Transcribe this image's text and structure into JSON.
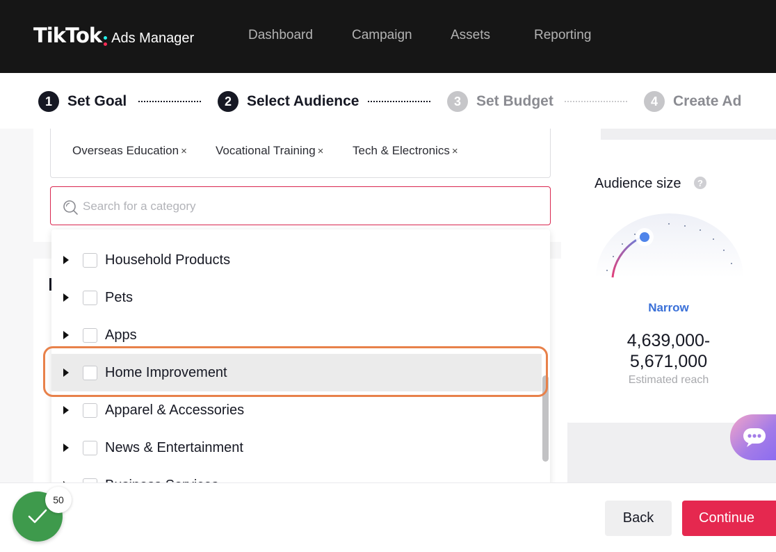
{
  "header": {
    "logo_main": "TikTok",
    "logo_sub": "Ads Manager",
    "nav": [
      "Dashboard",
      "Campaign",
      "Assets",
      "Reporting"
    ]
  },
  "steps": [
    {
      "num": "1",
      "label": "Set Goal",
      "state": "done"
    },
    {
      "num": "2",
      "label": "Select Audience",
      "state": "active"
    },
    {
      "num": "3",
      "label": "Set Budget",
      "state": "inactive"
    },
    {
      "num": "4",
      "label": "Create Ad",
      "state": "inactive"
    }
  ],
  "selected_tags": [
    "Overseas Education",
    "Vocational Training",
    "Tech & Electronics"
  ],
  "tag_remove_symbol": "×",
  "search": {
    "placeholder": "Search for a category",
    "value": ""
  },
  "categories": [
    "Household Products",
    "Pets",
    "Apps",
    "Home Improvement",
    "Apparel & Accessories",
    "News & Entertainment",
    "Business Services"
  ],
  "highlighted_category": "Home Improvement",
  "audience": {
    "title": "Audience size",
    "help_icon": "?",
    "level": "Narrow",
    "range_line1": "4,639,000-",
    "range_line2": "5,671,000",
    "subtitle": "Estimated reach"
  },
  "footer": {
    "back_label": "Back",
    "continue_label": "Continue",
    "progress_count": "50"
  },
  "colors": {
    "accent": "#e5284f",
    "level_blue": "#3a70d8",
    "highlight_ring": "#e8814a",
    "success_green": "#3e9a4c"
  }
}
